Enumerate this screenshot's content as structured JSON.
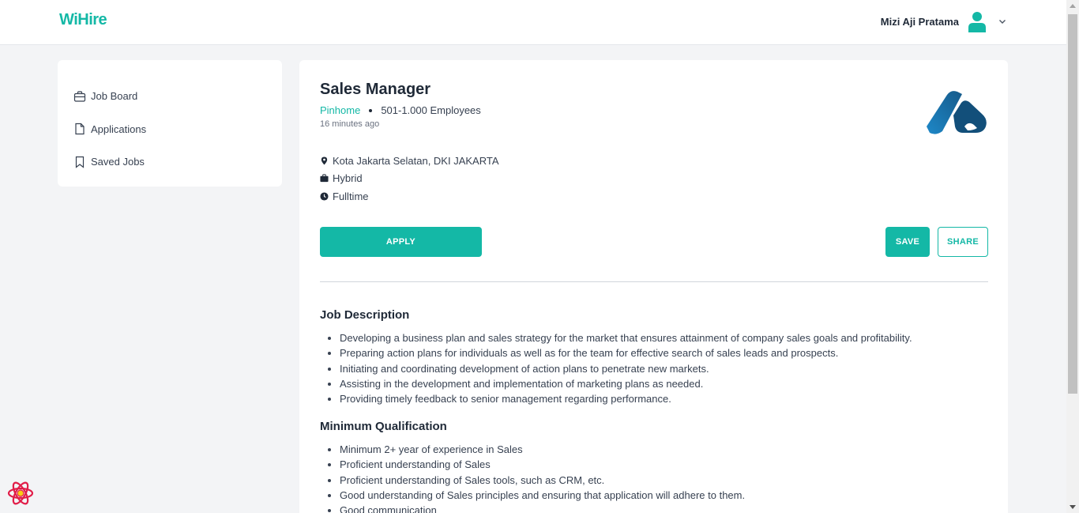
{
  "app": {
    "logo": "WiHire"
  },
  "header": {
    "user_name": "Mizi Aji Pratama"
  },
  "sidebar": {
    "items": [
      {
        "label": "Job Board",
        "icon": "briefcase-icon"
      },
      {
        "label": "Applications",
        "icon": "document-icon"
      },
      {
        "label": "Saved Jobs",
        "icon": "bookmark-icon"
      }
    ]
  },
  "job": {
    "title": "Sales Manager",
    "company": "Pinhome",
    "company_size": "501-1.000 Employees",
    "posted": "16 minutes ago",
    "location": "Kota Jakarta Selatan, DKI JAKARTA",
    "work_mode": "Hybrid",
    "job_type": "Fulltime"
  },
  "actions": {
    "apply": "APPLY",
    "save": "SAVE",
    "share": "SHARE"
  },
  "description": {
    "title": "Job Description",
    "items": [
      "Developing a business plan and sales strategy for the market that ensures attainment of company sales goals and profitability.",
      "Preparing action plans for individuals as well as for the team for effective search of sales leads and prospects.",
      "Initiating and coordinating development of action plans to penetrate new markets.",
      "Assisting in the development and implementation of marketing plans as needed.",
      "Providing timely feedback to senior management regarding performance."
    ]
  },
  "qualification": {
    "title": "Minimum Qualification",
    "items": [
      "Minimum 2+ year of experience in Sales",
      "Proficient understanding of Sales",
      "Proficient understanding of Sales tools, such as CRM, etc.",
      "Good understanding of Sales principles and ensuring that application will adhere to them.",
      "Good communication"
    ]
  },
  "colors": {
    "accent": "#14b8a6",
    "background": "#f3f4f6"
  }
}
